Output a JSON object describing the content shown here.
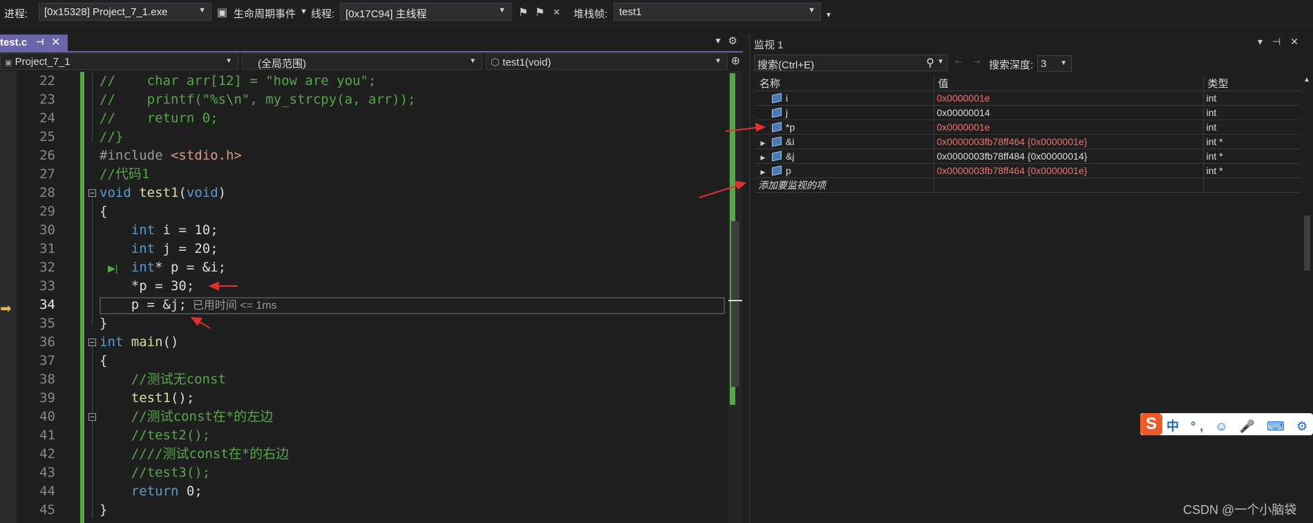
{
  "toolbar": {
    "process_label": "进程:",
    "process_value": "[0x15328] Project_7_1.exe",
    "lifecycle_label": "生命周期事件",
    "thread_label": "线程:",
    "thread_value": "[0x17C94] 主线程",
    "stackframe_label": "堆栈帧:",
    "stackframe_value": "test1"
  },
  "editor": {
    "tab_label": "test.c",
    "nav_project": "Project_7_1",
    "nav_scope": "(全局范围)",
    "nav_function": "test1(void)",
    "current_line": 34,
    "elapsed_label": "已用时间 <= 1ms",
    "line_numbers": [
      "22",
      "23",
      "24",
      "25",
      "26",
      "27",
      "28",
      "29",
      "30",
      "31",
      "32",
      "33",
      "34",
      "35",
      "36",
      "37",
      "38",
      "39",
      "40",
      "41",
      "42",
      "43",
      "44",
      "45"
    ],
    "code_lines": [
      {
        "ln": "22",
        "text": "//    char arr[12] = \"how are you\";"
      },
      {
        "ln": "23",
        "text": "//    printf(\"%s\\n\", my_strcpy(a, arr));"
      },
      {
        "ln": "24",
        "text": "//    return 0;"
      },
      {
        "ln": "25",
        "text": "//}"
      },
      {
        "ln": "26",
        "text": "#include <stdio.h>"
      },
      {
        "ln": "27",
        "text": "//代码1"
      },
      {
        "ln": "28",
        "text": "void test1(void)"
      },
      {
        "ln": "29",
        "text": "{"
      },
      {
        "ln": "30",
        "text": "    int i = 10;"
      },
      {
        "ln": "31",
        "text": "    int j = 20;"
      },
      {
        "ln": "32",
        "text": "    int* p = &i;"
      },
      {
        "ln": "33",
        "text": "    *p = 30;"
      },
      {
        "ln": "34",
        "text": "    p = &j;"
      },
      {
        "ln": "35",
        "text": "}"
      },
      {
        "ln": "36",
        "text": "int main()"
      },
      {
        "ln": "37",
        "text": "{"
      },
      {
        "ln": "38",
        "text": "    //测试无const"
      },
      {
        "ln": "39",
        "text": "    test1();"
      },
      {
        "ln": "40",
        "text": "    //测试const在*的左边"
      },
      {
        "ln": "41",
        "text": "    //test2();"
      },
      {
        "ln": "42",
        "text": "    ////测试const在*的右边"
      },
      {
        "ln": "43",
        "text": "    //test3();"
      },
      {
        "ln": "44",
        "text": "    return 0;"
      },
      {
        "ln": "45",
        "text": "}"
      }
    ]
  },
  "watch": {
    "title": "监视 1",
    "search_placeholder": "搜索(Ctrl+E)",
    "depth_label": "搜索深度:",
    "depth_value": "3",
    "columns": {
      "name": "名称",
      "value": "值",
      "type": "类型"
    },
    "rows": [
      {
        "name": "i",
        "value": "0x0000001e",
        "type": "int",
        "expandable": false,
        "changed": true
      },
      {
        "name": "j",
        "value": "0x00000014",
        "type": "int",
        "expandable": false,
        "changed": false
      },
      {
        "name": "*p",
        "value": "0x0000001e",
        "type": "int",
        "expandable": false,
        "changed": true
      },
      {
        "name": "&i",
        "value": "0x0000003fb78ff464 {0x0000001e}",
        "type": "int *",
        "expandable": true,
        "changed": true
      },
      {
        "name": "&j",
        "value": "0x0000003fb78ff484 {0x00000014}",
        "type": "int *",
        "expandable": true,
        "changed": false
      },
      {
        "name": "p",
        "value": "0x0000003fb78ff464 {0x0000001e}",
        "type": "int *",
        "expandable": true,
        "changed": true
      }
    ],
    "add_item_label": "添加要监视的项"
  },
  "ime": {
    "text": "中 °, ☺ 🎤 ⌨ ⚙ 👕 ▦"
  },
  "watermark": "CSDN @一个小脑袋",
  "colors": {
    "accent_tab": "#6a64a8",
    "changed_value": "#f07070",
    "annotation_arrow": "#e03030",
    "comment": "#57a64a",
    "keyword": "#569cd6"
  }
}
